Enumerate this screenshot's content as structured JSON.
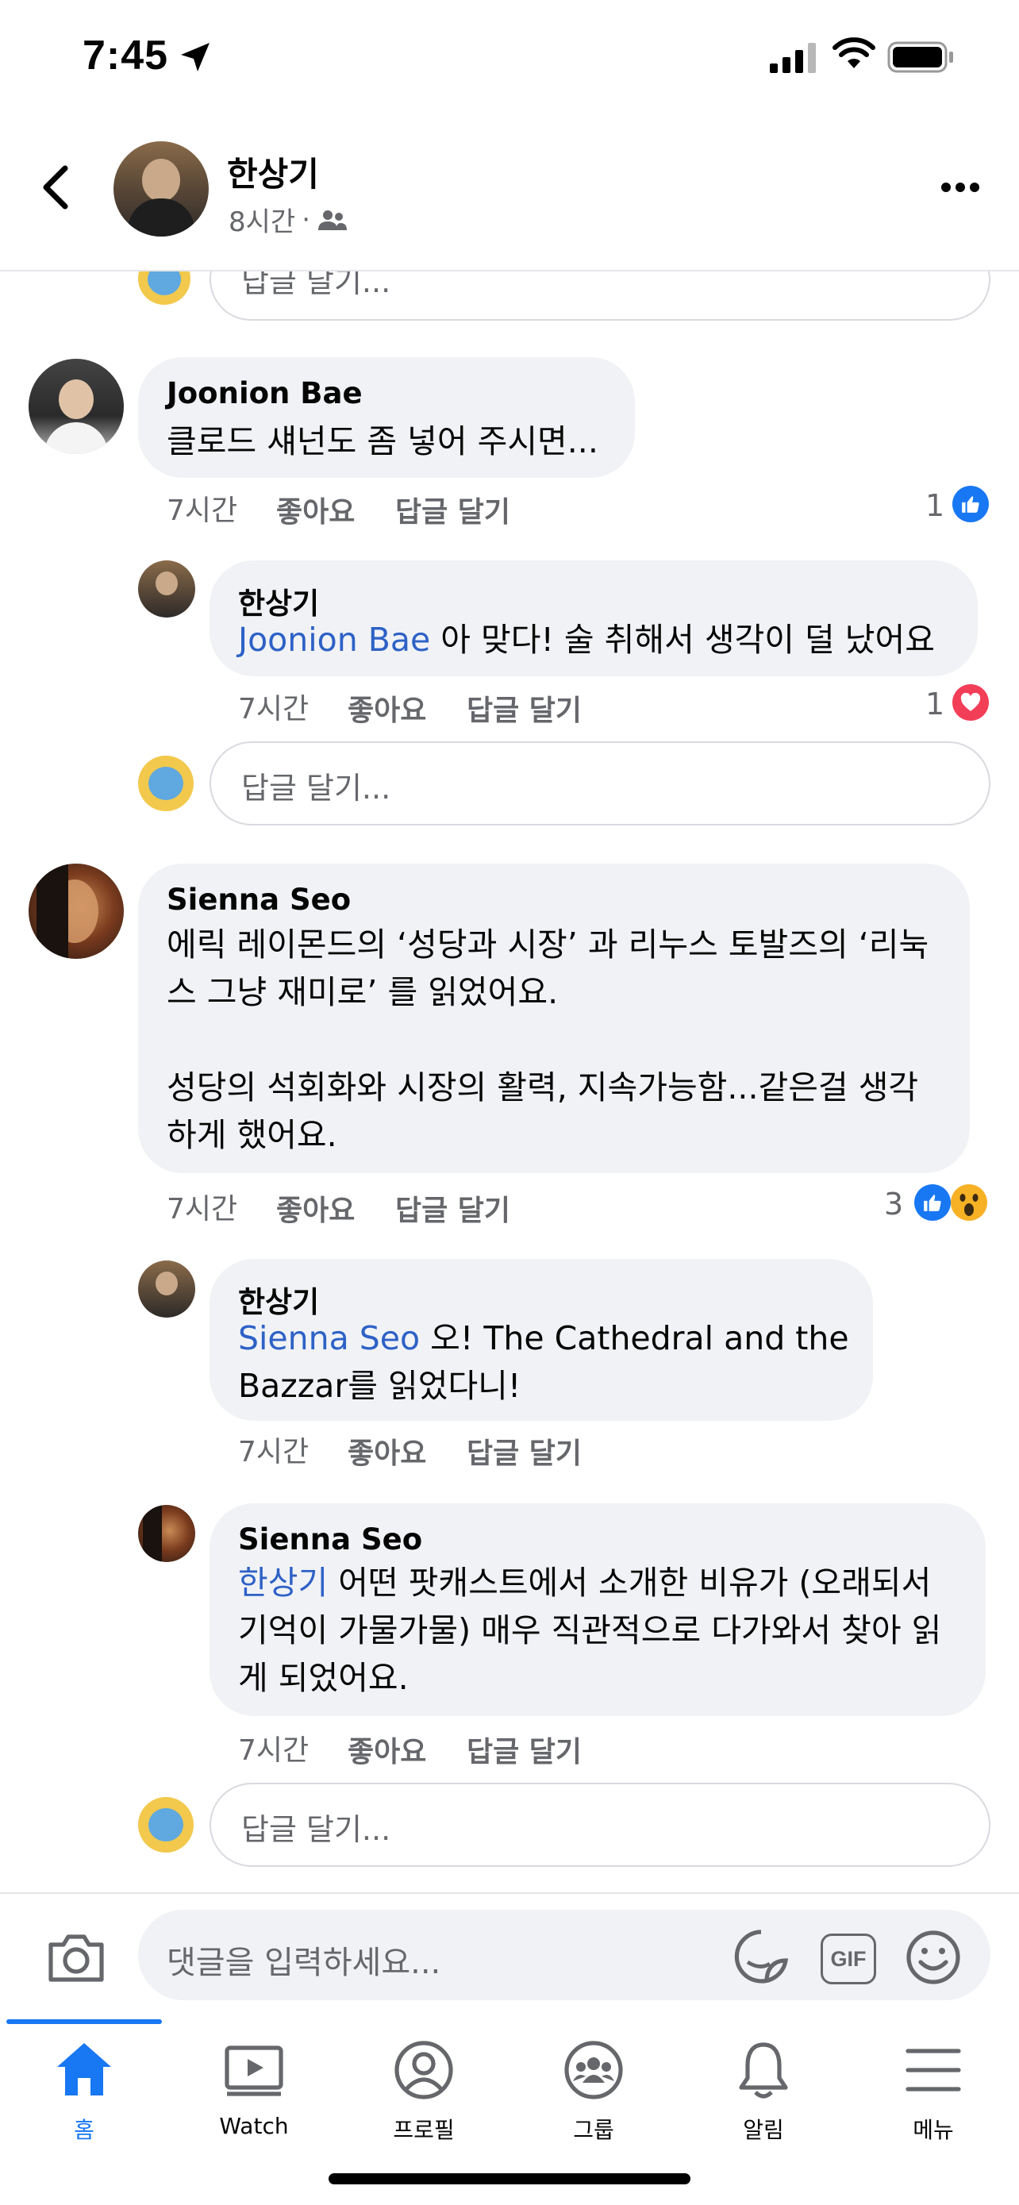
{
  "status": {
    "time": "7:45"
  },
  "post": {
    "author": "한상기",
    "age": "8시간"
  },
  "top_reply_placeholder": "답글 달기...",
  "comments": [
    {
      "name": "Joonion Bae",
      "text": "클로드 섀넌도 좀 넣어 주시면...",
      "time": "7시간",
      "like": "좋아요",
      "reply": "답글 달기",
      "reactions": "1",
      "replies": [
        {
          "name": "한상기",
          "mention": "Joonion Bae",
          "text": " 아 맞다! 술 취해서 생각이 덜 났어요",
          "time": "7시간",
          "like": "좋아요",
          "reply": "답글 달기",
          "reactions": "1"
        }
      ],
      "reply_placeholder": "답글 달기..."
    },
    {
      "name": "Sienna Seo",
      "text_lines": [
        "에릭 레이몬드의 ‘성당과 시장’ 과 리누스 토발즈의 ‘리눅",
        "스 그냥 재미로’ 를 읽었어요.",
        "",
        "성당의 석회화와 시장의 활력, 지속가능함...같은걸 생각",
        "하게 했어요."
      ],
      "time": "7시간",
      "like": "좋아요",
      "reply": "답글 달기",
      "reactions": "3",
      "replies": [
        {
          "name": "한상기",
          "mention": "Sienna Seo",
          "text_l1": " 오! The Cathedral and the",
          "text_l2": "Bazzar를 읽었다니!",
          "time": "7시간",
          "like": "좋아요",
          "reply": "답글 달기"
        },
        {
          "name": "Sienna Seo",
          "mention": "한상기",
          "text_l1": " 어떤 팟캐스트에서 소개한 비유가 (오래되서",
          "text_l2": "기억이 가물가물) 매우 직관적으로 다가와서 찾아 읽",
          "text_l3": "게 되었어요.",
          "time": "7시간",
          "like": "좋아요",
          "reply": "답글 달기"
        }
      ],
      "reply_placeholder": "답글 달기..."
    }
  ],
  "composer": {
    "placeholder": "댓글을 입력하세요...",
    "gif": "GIF"
  },
  "tabs": [
    {
      "label": "홈",
      "icon": "home-icon",
      "active": true
    },
    {
      "label": "Watch",
      "icon": "watch-icon"
    },
    {
      "label": "프로필",
      "icon": "profile-icon"
    },
    {
      "label": "그룹",
      "icon": "groups-icon"
    },
    {
      "label": "알림",
      "icon": "bell-icon"
    },
    {
      "label": "메뉴",
      "icon": "menu-icon"
    }
  ],
  "colors": {
    "accent": "#1877f2",
    "mention": "#2d61c6",
    "bubble": "#f0f2f5",
    "love": "#f33e58"
  }
}
